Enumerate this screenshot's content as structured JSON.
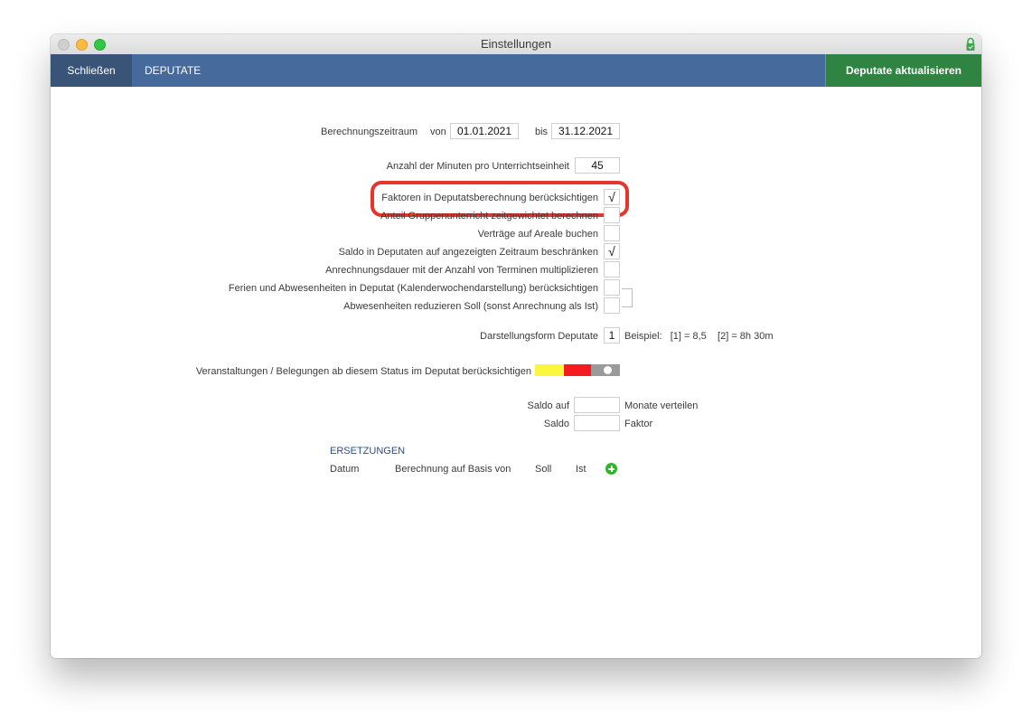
{
  "window": {
    "title": "Einstellungen"
  },
  "toolbar": {
    "close_label": "Schließen",
    "tab_label": "DEPUTATE",
    "update_label": "Deputate aktualisieren"
  },
  "period": {
    "label": "Berechnungszeitraum",
    "from_label": "von",
    "from_value": "01.01.2021",
    "to_label": "bis",
    "to_value": "31.12.2021"
  },
  "minutes": {
    "label": "Anzahl der Minuten pro Unterrichtseinheit",
    "value": "45"
  },
  "options": [
    {
      "label": "Faktoren in Deputatsberechnung berücksichtigen",
      "mark": "√"
    },
    {
      "label": "Anteil Gruppenunterricht zeitgewichtet berechnen",
      "mark": ""
    },
    {
      "label": "Verträge auf Areale buchen",
      "mark": ""
    },
    {
      "label": "Saldo in Deputaten auf angezeigten Zeitraum beschränken",
      "mark": "√"
    },
    {
      "label": "Anrechnungsdauer mit der Anzahl von Terminen multiplizieren",
      "mark": ""
    },
    {
      "label": "Ferien und Abwesenheiten in Deputat (Kalenderwochendarstellung) berücksichtigen",
      "mark": ""
    },
    {
      "label": "Abwesenheiten reduzieren Soll (sonst Anrechnung als Ist)",
      "mark": ""
    }
  ],
  "display": {
    "label": "Darstellungsform Deputate",
    "value": "1",
    "example": "Beispiel:   [1] = 8,5    [2] = 8h 30m"
  },
  "status": {
    "label": "Veranstaltungen / Belegungen ab diesem Status im Deputat berücksichtigen",
    "colors": [
      "#fbf63e",
      "#f41c1c",
      "#9a9a9a"
    ]
  },
  "balance": {
    "distribute_label": "Saldo auf",
    "distribute_value": "",
    "distribute_suffix": "Monate verteilen",
    "factor_label": "Saldo",
    "factor_value": "",
    "factor_suffix": "Faktor"
  },
  "replacements": {
    "title": "ERSETZUNGEN",
    "columns": [
      "Datum",
      "Berechnung auf Basis von",
      "Soll",
      "Ist"
    ]
  }
}
